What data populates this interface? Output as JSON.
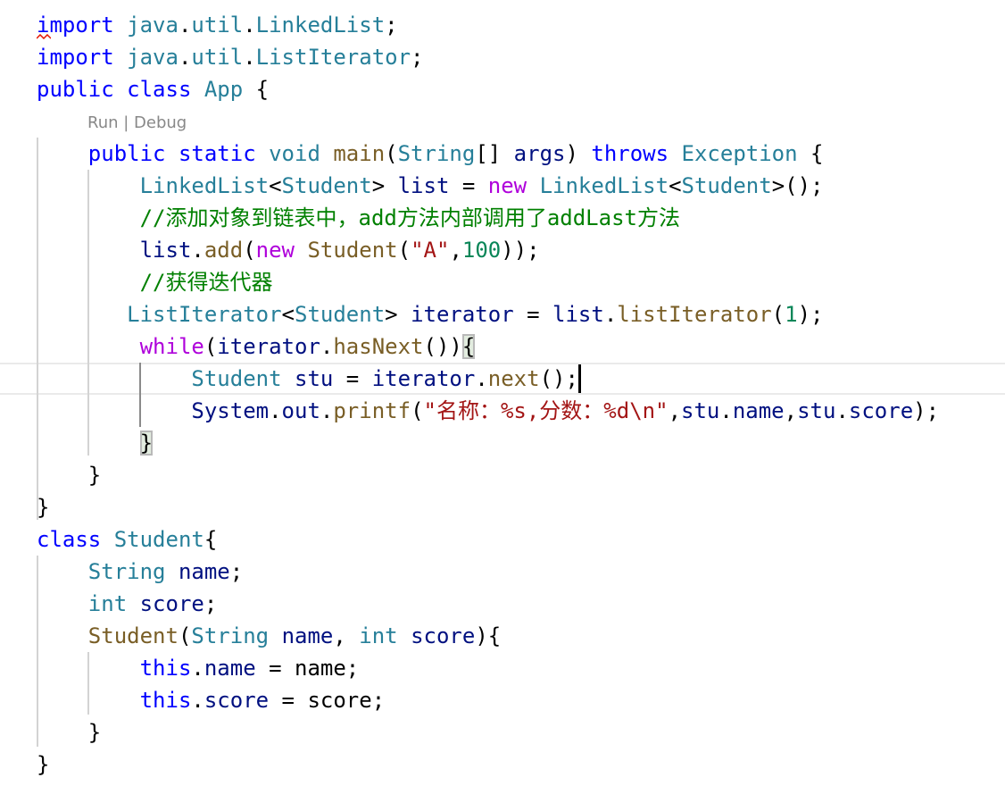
{
  "editor": {
    "codelens": {
      "run": "Run",
      "separator": " | ",
      "debug": "Debug"
    },
    "lines": [
      [
        [
          "import",
          "kw"
        ],
        [
          " ",
          "p"
        ],
        [
          "java",
          "ty"
        ],
        [
          ".",
          "p"
        ],
        [
          "util",
          "ty"
        ],
        [
          ".",
          "p"
        ],
        [
          "LinkedList",
          "ty"
        ],
        [
          ";",
          "p"
        ]
      ],
      [
        [
          "import",
          "kw"
        ],
        [
          " ",
          "p"
        ],
        [
          "java",
          "ty"
        ],
        [
          ".",
          "p"
        ],
        [
          "util",
          "ty"
        ],
        [
          ".",
          "p"
        ],
        [
          "ListIterator",
          "ty"
        ],
        [
          ";",
          "p"
        ]
      ],
      [
        [
          "public",
          "kw"
        ],
        [
          " ",
          "p"
        ],
        [
          "class",
          "kw"
        ],
        [
          " ",
          "p"
        ],
        [
          "App",
          "ty"
        ],
        [
          " {",
          "p"
        ]
      ],
      "CODELENS",
      [
        [
          "    ",
          "p"
        ],
        [
          "public",
          "kw"
        ],
        [
          " ",
          "p"
        ],
        [
          "static",
          "kw"
        ],
        [
          " ",
          "p"
        ],
        [
          "void",
          "ty"
        ],
        [
          " ",
          "p"
        ],
        [
          "main",
          "fn"
        ],
        [
          "(",
          "p"
        ],
        [
          "String",
          "ty"
        ],
        [
          "[] ",
          "p"
        ],
        [
          "args",
          "va"
        ],
        [
          ") ",
          "p"
        ],
        [
          "throws",
          "kw"
        ],
        [
          " ",
          "p"
        ],
        [
          "Exception",
          "ty"
        ],
        [
          " {",
          "p"
        ]
      ],
      [
        [
          "        ",
          "p"
        ],
        [
          "LinkedList",
          "ty"
        ],
        [
          "<",
          "p"
        ],
        [
          "Student",
          "ty"
        ],
        [
          "> ",
          "p"
        ],
        [
          "list",
          "va"
        ],
        [
          " = ",
          "p"
        ],
        [
          "new",
          "ctl"
        ],
        [
          " ",
          "p"
        ],
        [
          "LinkedList",
          "ty"
        ],
        [
          "<",
          "p"
        ],
        [
          "Student",
          "ty"
        ],
        [
          ">();",
          "p"
        ]
      ],
      [
        [
          "        ",
          "p"
        ],
        [
          "//添加对象到链表中，add方法内部调用了addLast方法",
          "cm"
        ]
      ],
      [
        [
          "        ",
          "p"
        ],
        [
          "list",
          "va"
        ],
        [
          ".",
          "p"
        ],
        [
          "add",
          "fn"
        ],
        [
          "(",
          "p"
        ],
        [
          "new",
          "ctl"
        ],
        [
          " ",
          "p"
        ],
        [
          "Student",
          "fn"
        ],
        [
          "(",
          "p"
        ],
        [
          "\"A\"",
          "str"
        ],
        [
          ",",
          "p"
        ],
        [
          "100",
          "num"
        ],
        [
          "));",
          "p"
        ]
      ],
      [
        [
          "        ",
          "p"
        ],
        [
          "//获得迭代器",
          "cm"
        ]
      ],
      [
        [
          "       ",
          "p"
        ],
        [
          "ListIterator",
          "ty"
        ],
        [
          "<",
          "p"
        ],
        [
          "Student",
          "ty"
        ],
        [
          "> ",
          "p"
        ],
        [
          "iterator",
          "va"
        ],
        [
          " = ",
          "p"
        ],
        [
          "list",
          "va"
        ],
        [
          ".",
          "p"
        ],
        [
          "listIterator",
          "fn"
        ],
        [
          "(",
          "p"
        ],
        [
          "1",
          "num"
        ],
        [
          ");",
          "p"
        ]
      ],
      [
        [
          "        ",
          "p"
        ],
        [
          "while",
          "ctl"
        ],
        [
          "(",
          "p"
        ],
        [
          "iterator",
          "va"
        ],
        [
          ".",
          "p"
        ],
        [
          "hasNext",
          "fn"
        ],
        [
          "())",
          "p"
        ],
        [
          "{",
          "p match"
        ]
      ],
      [
        [
          "            ",
          "p"
        ],
        [
          "Student",
          "ty"
        ],
        [
          " ",
          "p"
        ],
        [
          "stu",
          "va"
        ],
        [
          " = ",
          "p"
        ],
        [
          "iterator",
          "va"
        ],
        [
          ".",
          "p"
        ],
        [
          "next",
          "fn"
        ],
        [
          "();",
          "p"
        ]
      ],
      [
        [
          "            ",
          "p"
        ],
        [
          "System",
          "va"
        ],
        [
          ".",
          "p"
        ],
        [
          "out",
          "va"
        ],
        [
          ".",
          "p"
        ],
        [
          "printf",
          "fn"
        ],
        [
          "(",
          "p"
        ],
        [
          "\"名称：%s,分数：%d\\n\"",
          "str"
        ],
        [
          ",",
          "p"
        ],
        [
          "stu",
          "va"
        ],
        [
          ".",
          "p"
        ],
        [
          "name",
          "va"
        ],
        [
          ",",
          "p"
        ],
        [
          "stu",
          "va"
        ],
        [
          ".",
          "p"
        ],
        [
          "score",
          "va"
        ],
        [
          ");",
          "p"
        ]
      ],
      [
        [
          "        ",
          "p"
        ],
        [
          "}",
          "p match"
        ]
      ],
      [
        [
          "    ",
          "p"
        ],
        [
          "}",
          "p"
        ]
      ],
      [
        [
          "}",
          "p"
        ]
      ],
      [
        [
          "class",
          "kw"
        ],
        [
          " ",
          "p"
        ],
        [
          "Student",
          "ty"
        ],
        [
          "{",
          "p"
        ]
      ],
      [
        [
          "    ",
          "p"
        ],
        [
          "String",
          "ty"
        ],
        [
          " ",
          "p"
        ],
        [
          "name",
          "va"
        ],
        [
          ";",
          "p"
        ]
      ],
      [
        [
          "    ",
          "p"
        ],
        [
          "int",
          "ty"
        ],
        [
          " ",
          "p"
        ],
        [
          "score",
          "va"
        ],
        [
          ";",
          "p"
        ]
      ],
      [
        [
          "    ",
          "p"
        ],
        [
          "Student",
          "fn"
        ],
        [
          "(",
          "p"
        ],
        [
          "String",
          "ty"
        ],
        [
          " ",
          "p"
        ],
        [
          "name",
          "va"
        ],
        [
          ", ",
          "p"
        ],
        [
          "int",
          "ty"
        ],
        [
          " ",
          "p"
        ],
        [
          "score",
          "va"
        ],
        [
          "){",
          "p"
        ]
      ],
      [
        [
          "        ",
          "p"
        ],
        [
          "this",
          "kw"
        ],
        [
          ".",
          "p"
        ],
        [
          "name",
          "va"
        ],
        [
          " = name;",
          "p"
        ]
      ],
      [
        [
          "        ",
          "p"
        ],
        [
          "this",
          "kw"
        ],
        [
          ".",
          "p"
        ],
        [
          "score",
          "va"
        ],
        [
          " = score;",
          "p"
        ]
      ],
      [
        [
          "    ",
          "p"
        ],
        [
          "}",
          "p"
        ]
      ],
      [
        [
          "}",
          "p"
        ]
      ]
    ],
    "current_line": 11,
    "colors": {
      "keyword": "#0000ff",
      "type": "#267f99",
      "function": "#795e26",
      "variable": "#001080",
      "control": "#af00db",
      "comment": "#008000",
      "string": "#a31515",
      "number": "#098658",
      "error_squiggle": "#e51400"
    }
  }
}
